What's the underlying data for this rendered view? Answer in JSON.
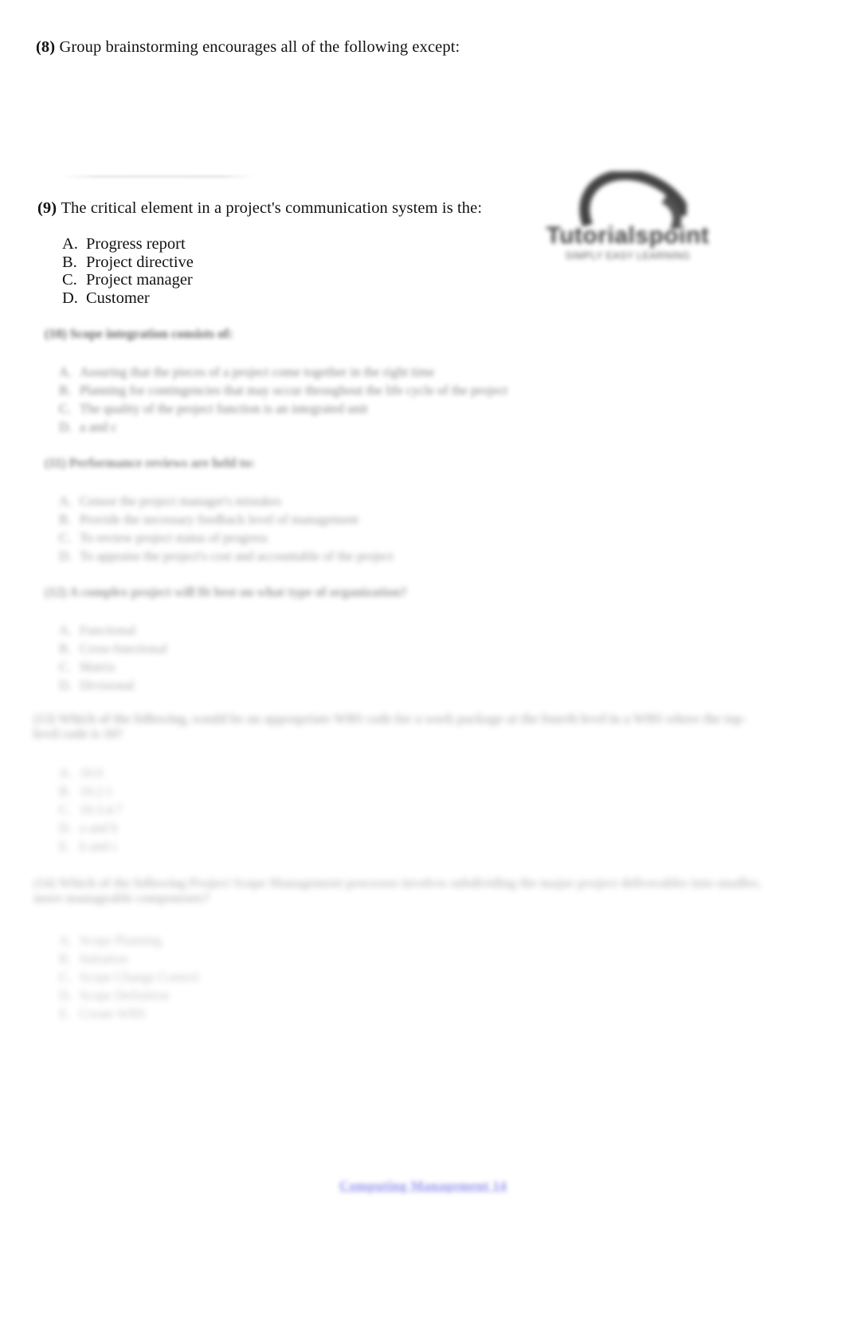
{
  "document": {
    "kind": "exam-question-sheet",
    "background_color": "#ffffff",
    "text_color": "#111111"
  },
  "logo": {
    "name": "tutorials-point-logo",
    "wordmark": "Tutorialspoint",
    "tagline": "SIMPLY EASY LEARNING"
  },
  "questions": [
    {
      "number": "(8)",
      "stem": "Group brainstorming encourages all of the following except:",
      "legible": true,
      "options": []
    },
    {
      "number": "(9)",
      "stem": "The critical element in a project's communication system is the:",
      "legible": true,
      "options": [
        {
          "letter": "A.",
          "text": "Progress report"
        },
        {
          "letter": "B.",
          "text": "Project directive"
        },
        {
          "letter": "C.",
          "text": "Project manager"
        },
        {
          "letter": "D.",
          "text": "Customer"
        }
      ]
    },
    {
      "number": "(10)",
      "stem": "Scope integration consists of:",
      "legible": false,
      "options": [
        {
          "letter": "A.",
          "text": "Assuring that the pieces of a project come together in the right time"
        },
        {
          "letter": "B.",
          "text": "Planning for contingencies that may occur throughout the life cycle of the project"
        },
        {
          "letter": "C.",
          "text": "The quality of the project function is an integrated unit"
        },
        {
          "letter": "D.",
          "text": "a and c"
        }
      ]
    },
    {
      "number": "(11)",
      "stem": "Performance reviews are held to:",
      "legible": false,
      "options": [
        {
          "letter": "A.",
          "text": "Censor the project manager's mistakes"
        },
        {
          "letter": "B.",
          "text": "Provide the necessary feedback level of management"
        },
        {
          "letter": "C.",
          "text": "To review project status of progress"
        },
        {
          "letter": "D.",
          "text": "To appraise the project's cost and accountable of the project"
        }
      ]
    },
    {
      "number": "(12)",
      "stem": "A complex project will fit best on what type of organization?",
      "legible": false,
      "options": [
        {
          "letter": "A.",
          "text": "Functional"
        },
        {
          "letter": "B.",
          "text": "Cross-functional"
        },
        {
          "letter": "C.",
          "text": "Matrix"
        },
        {
          "letter": "D.",
          "text": "Divisional"
        }
      ]
    },
    {
      "number": "(13)",
      "stem": "Which of the following, would be an appropriate WBS code for a work package at the fourth level in a WBS where the top-level code is 10?",
      "legible": false,
      "options": [
        {
          "letter": "A.",
          "text": "10.0"
        },
        {
          "letter": "B.",
          "text": "10.2.1"
        },
        {
          "letter": "C.",
          "text": "10.3.4.7"
        },
        {
          "letter": "D.",
          "text": "a and b"
        },
        {
          "letter": "E.",
          "text": "b and c"
        }
      ]
    },
    {
      "number": "(14)",
      "stem": "Which of the following Project Scope Management processes involves subdividing the major project deliverables into smaller, more manageable components?",
      "legible": false,
      "options": [
        {
          "letter": "A.",
          "text": "Scope Planning"
        },
        {
          "letter": "B.",
          "text": "Initiation"
        },
        {
          "letter": "C.",
          "text": "Scope Change Control"
        },
        {
          "letter": "D.",
          "text": "Scope Definition"
        },
        {
          "letter": "E.",
          "text": "Create WBS"
        }
      ]
    }
  ],
  "footer": {
    "link_text": "Computing Management 14",
    "link_color": "#6a6ae8"
  }
}
